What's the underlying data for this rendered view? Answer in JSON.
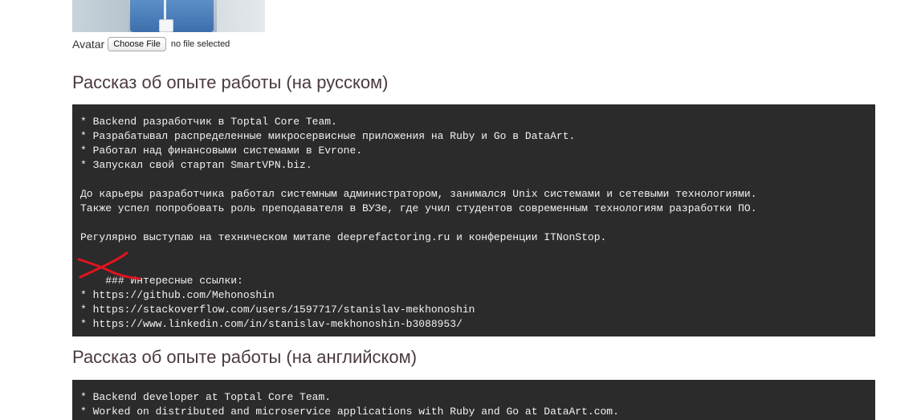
{
  "avatar": {
    "label": "Avatar",
    "button_label": "Choose File",
    "file_status": "no file selected"
  },
  "sections": {
    "ru": {
      "title": "Рассказ об опыте работы (на русском)",
      "lines": [
        "* Backend разработчик в Toptal Core Team.",
        "* Разрабатывал распределенные микросервисные приложения на Ruby и Go в DataArt.",
        "* Работал над финансовыми системами в Evrone.",
        "* Запускал свой стартап SmartVPN.biz.",
        "",
        "До карьеры разработчика работал системным администратором, занимался Unix системами и сетевыми технологиями.",
        "Также успел попробовать роль преподавателя в ВУЗе, где учил студентов современным технологиям разработки ПО.",
        "",
        "Регулярно выступаю на техническом митапе deeprefactoring.ru и конференции ITNonStop.",
        "",
        "### Интересные ссылки:",
        "",
        "* https://github.com/Mehonoshin",
        "* https://stackoverflow.com/users/1597717/stanislav-mekhonoshin",
        "* https://www.linkedin.com/in/stanislav-mekhonoshin-b3088953/"
      ]
    },
    "en": {
      "title": "Рассказ об опыте работы (на английском)",
      "lines": [
        "* Backend developer at Toptal Core Team.",
        "* Worked on distributed and microservice applications with Ruby and Go at DataArt.com."
      ]
    }
  },
  "colors": {
    "code_bg": "#2b2b2b",
    "code_text": "#f2f2f2",
    "title_text": "#4a3a40",
    "annotation_red": "#e0141e"
  }
}
